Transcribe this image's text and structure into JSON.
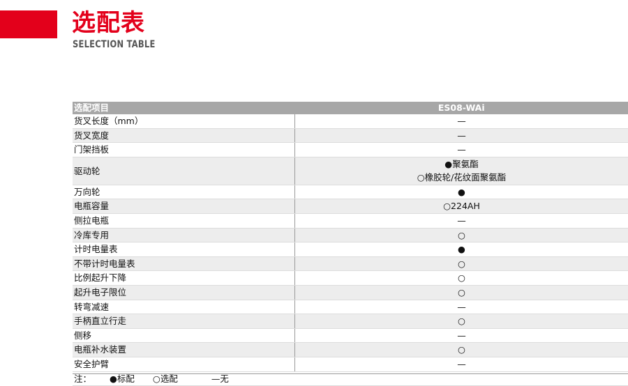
{
  "header": {
    "title": "选配表",
    "subtitle": "SELECTION TABLE"
  },
  "table": {
    "col_item": "选配项目",
    "col_model": "ES08-WAi",
    "rows": [
      {
        "name": "货叉长度（mm）",
        "value": "—"
      },
      {
        "name": "货叉宽度",
        "value": "—"
      },
      {
        "name": "门架挡板",
        "value": "—"
      },
      {
        "name": "驱动轮",
        "value": "●聚氨酯",
        "value2": "○橡胶轮/花纹面聚氨酯"
      },
      {
        "name": "万向轮",
        "value": "●"
      },
      {
        "name": "电瓶容量",
        "value": "○224AH"
      },
      {
        "name": "侧拉电瓶",
        "value": "—"
      },
      {
        "name": "冷库专用",
        "value": "○"
      },
      {
        "name": "计时电量表",
        "value": "●"
      },
      {
        "name": "不带计时电量表",
        "value": "○"
      },
      {
        "name": "比例起升下降",
        "value": "○"
      },
      {
        "name": "起升电子限位",
        "value": "○"
      },
      {
        "name": "转弯减速",
        "value": "—"
      },
      {
        "name": "手柄直立行走",
        "value": "○"
      },
      {
        "name": "侧移",
        "value": "—"
      },
      {
        "name": "电瓶补水装置",
        "value": "○"
      },
      {
        "name": "安全护臂",
        "value": "—"
      }
    ],
    "note": {
      "label": "注：",
      "standard": "●标配",
      "optional": "○选配",
      "none": "—无"
    }
  },
  "colors": {
    "brand_red": "#e3001b",
    "header_gray": "#a7a7a7",
    "stripe_gray": "#ededed"
  }
}
